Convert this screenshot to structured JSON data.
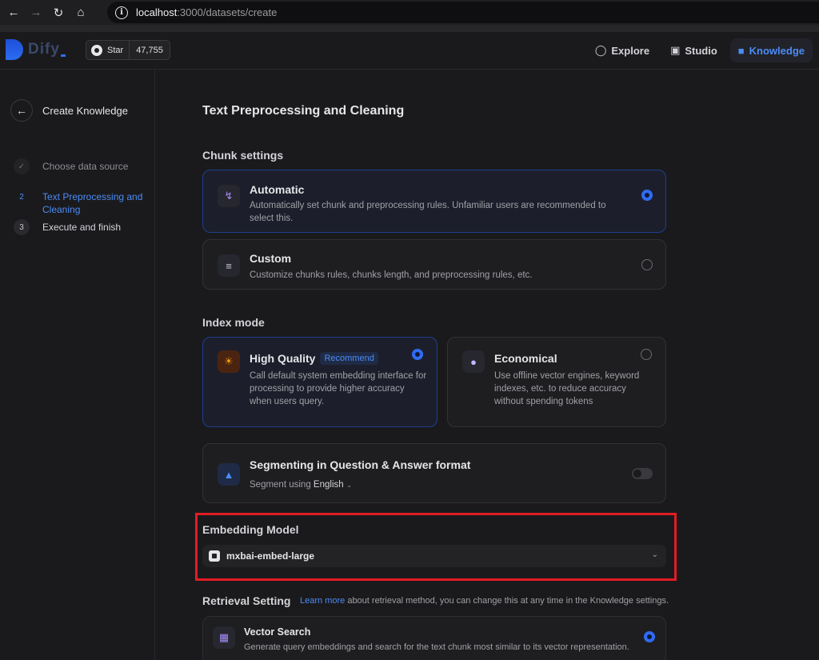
{
  "browser": {
    "url_host": "localhost",
    "url_path": ":3000/datasets/create"
  },
  "header": {
    "logo_text": "Dify",
    "github": {
      "star_label": "Star",
      "count": "47,755"
    },
    "nav": [
      {
        "label": "Explore",
        "icon": "compass-icon"
      },
      {
        "label": "Studio",
        "icon": "robot-icon"
      },
      {
        "label": "Knowledge",
        "icon": "book-icon",
        "active": true
      }
    ]
  },
  "sidebar": {
    "title": "Create Knowledge",
    "steps": [
      {
        "badge": "✓",
        "label": "Choose data source",
        "state": "done"
      },
      {
        "badge": "2",
        "label": "Text Preprocessing and Cleaning",
        "state": "current"
      },
      {
        "badge": "3",
        "label": "Execute and finish",
        "state": "next"
      }
    ]
  },
  "main": {
    "title": "Text Preprocessing and Cleaning",
    "chunk": {
      "section_title": "Chunk settings",
      "automatic": {
        "title": "Automatic",
        "desc": "Automatically set chunk and preprocessing rules. Unfamiliar users are recommended to select this.",
        "selected": true
      },
      "custom": {
        "title": "Custom",
        "desc": "Customize chunks rules, chunks length, and preprocessing rules, etc.",
        "selected": false
      }
    },
    "index": {
      "section_title": "Index mode",
      "high_quality": {
        "title": "High Quality",
        "badge": "Recommend",
        "desc": "Call default system embedding interface for processing to provide higher accuracy when users query.",
        "selected": true
      },
      "economical": {
        "title": "Economical",
        "desc": "Use offline vector engines, keyword indexes, etc. to reduce accuracy without spending tokens",
        "selected": false
      }
    },
    "qa": {
      "title": "Segmenting in Question & Answer format",
      "segment_prefix": "Segment using",
      "language": "English",
      "enabled": false
    },
    "embedding": {
      "section_title": "Embedding Model",
      "model": "mxbai-embed-large"
    },
    "retrieval": {
      "section_title": "Retrieval Setting",
      "learn_more": "Learn more",
      "note": " about retrieval method, you can change this at any time in the Knowledge settings.",
      "vector": {
        "title": "Vector Search",
        "desc": "Generate query embeddings and search for the text chunk most similar to its vector representation.",
        "selected": true
      }
    }
  },
  "colors": {
    "accent": "#2f6bf5",
    "highlight": "#e11d24"
  }
}
